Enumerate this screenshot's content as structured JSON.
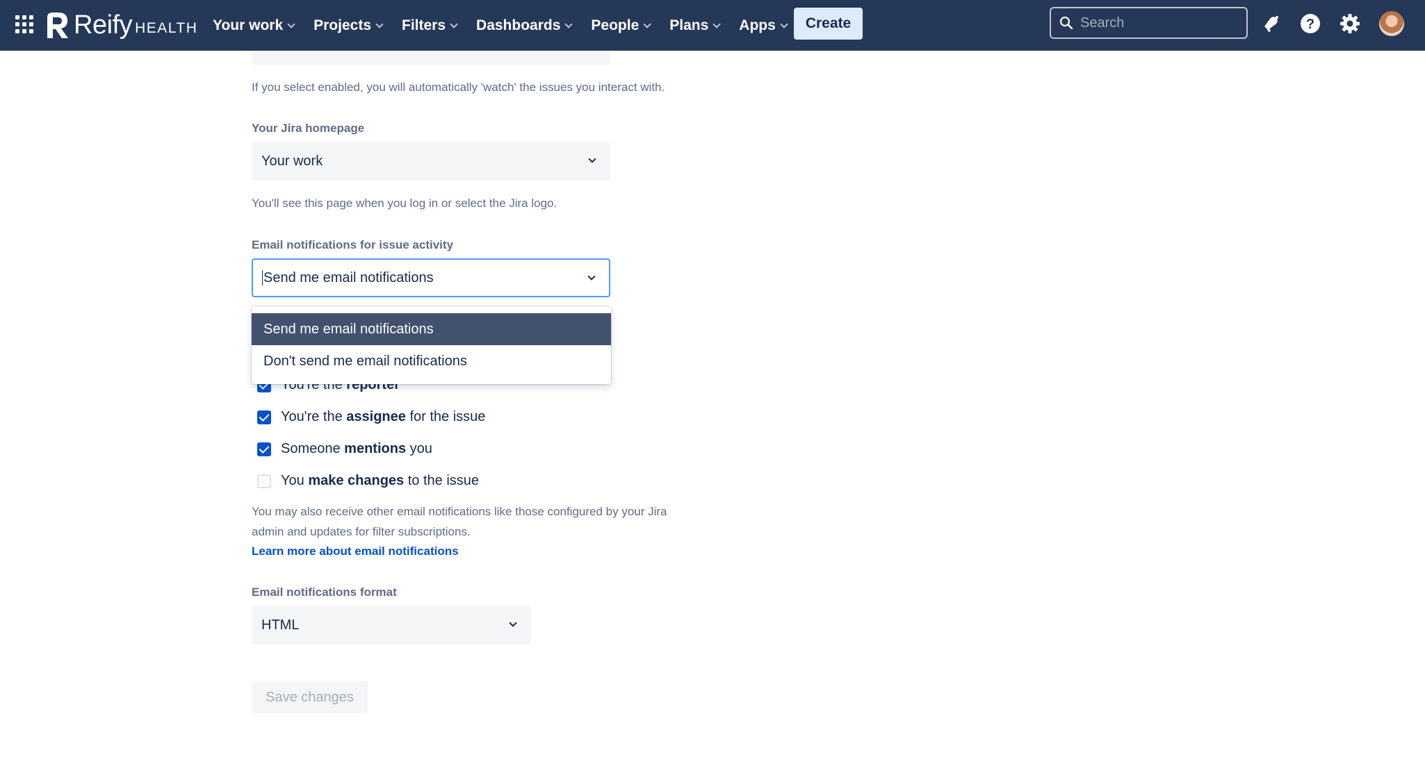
{
  "brand": {
    "name": "Reify",
    "suffix": "HEALTH"
  },
  "nav": {
    "items": [
      {
        "label": "Your work"
      },
      {
        "label": "Projects"
      },
      {
        "label": "Filters"
      },
      {
        "label": "Dashboards"
      },
      {
        "label": "People"
      },
      {
        "label": "Plans"
      },
      {
        "label": "Apps"
      }
    ],
    "create_label": "Create",
    "search_placeholder": "Search"
  },
  "settings": {
    "autowatch_helper": "If you select enabled, you will automatically 'watch' the issues you interact with.",
    "homepage": {
      "label": "Your Jira homepage",
      "value": "Your work",
      "helper": "You'll see this page when you log in or select the Jira logo."
    },
    "email_activity": {
      "label": "Email notifications for issue activity",
      "value": "Send me email notifications",
      "options": [
        "Send me email notifications",
        "Don't send me email notifications"
      ],
      "selected_option_index": 0
    },
    "checkboxes": [
      {
        "pre": "You're the ",
        "bold": "reporter",
        "post": "",
        "checked": true
      },
      {
        "pre": "You're the ",
        "bold": "assignee",
        "post": " for the issue",
        "checked": true
      },
      {
        "pre": "Someone ",
        "bold": "mentions",
        "post": " you",
        "checked": true
      },
      {
        "pre": "You ",
        "bold": "make changes",
        "post": " to the issue",
        "checked": false
      }
    ],
    "other_notifications_helper_line1": "You may also receive other email notifications like those configured by your Jira",
    "other_notifications_helper_line2": "admin and updates for filter subscriptions.",
    "learn_more_link": "Learn more about email notifications",
    "format": {
      "label": "Email notifications format",
      "value": "HTML"
    },
    "save_label": "Save changes"
  },
  "colors": {
    "nav_bg": "#253858",
    "accent": "#0052cc",
    "selected_option_bg": "#42526e",
    "focus_border": "#4c9aff"
  }
}
